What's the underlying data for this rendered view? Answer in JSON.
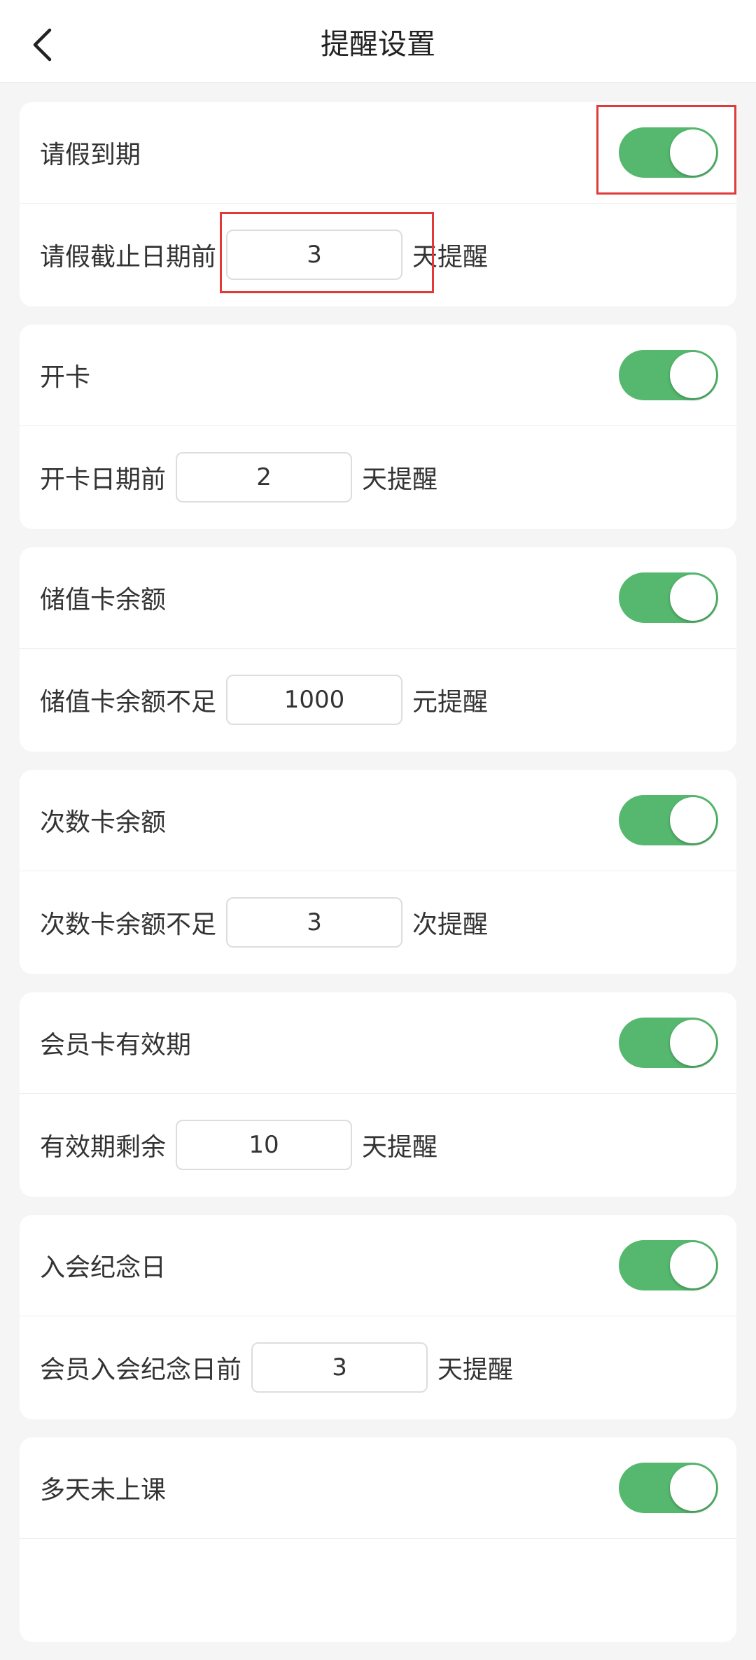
{
  "header": {
    "title": "提醒设置",
    "back_icon": "chevron-left-icon"
  },
  "colors": {
    "toggle_on": "#55b86e",
    "highlight": "#e03a3a"
  },
  "cards": [
    {
      "id": "leave-expiry",
      "toggle_label": "请假到期",
      "enabled": true,
      "prefix": "请假截止日期前",
      "value": "3",
      "suffix": "天提醒"
    },
    {
      "id": "card-activation",
      "toggle_label": "开卡",
      "enabled": true,
      "prefix": "开卡日期前",
      "value": "2",
      "suffix": "天提醒"
    },
    {
      "id": "stored-value-balance",
      "toggle_label": "储值卡余额",
      "enabled": true,
      "prefix": "储值卡余额不足",
      "value": "1000",
      "suffix": "元提醒"
    },
    {
      "id": "count-card-balance",
      "toggle_label": "次数卡余额",
      "enabled": true,
      "prefix": "次数卡余额不足",
      "value": "3",
      "suffix": "次提醒"
    },
    {
      "id": "membership-validity",
      "toggle_label": "会员卡有效期",
      "enabled": true,
      "prefix": "有效期剩余",
      "value": "10",
      "suffix": "天提醒"
    },
    {
      "id": "join-anniversary",
      "toggle_label": "入会纪念日",
      "enabled": true,
      "prefix": "会员入会纪念日前",
      "value": "3",
      "suffix": "天提醒"
    },
    {
      "id": "absence-days",
      "toggle_label": "多天未上课",
      "enabled": true
    }
  ]
}
